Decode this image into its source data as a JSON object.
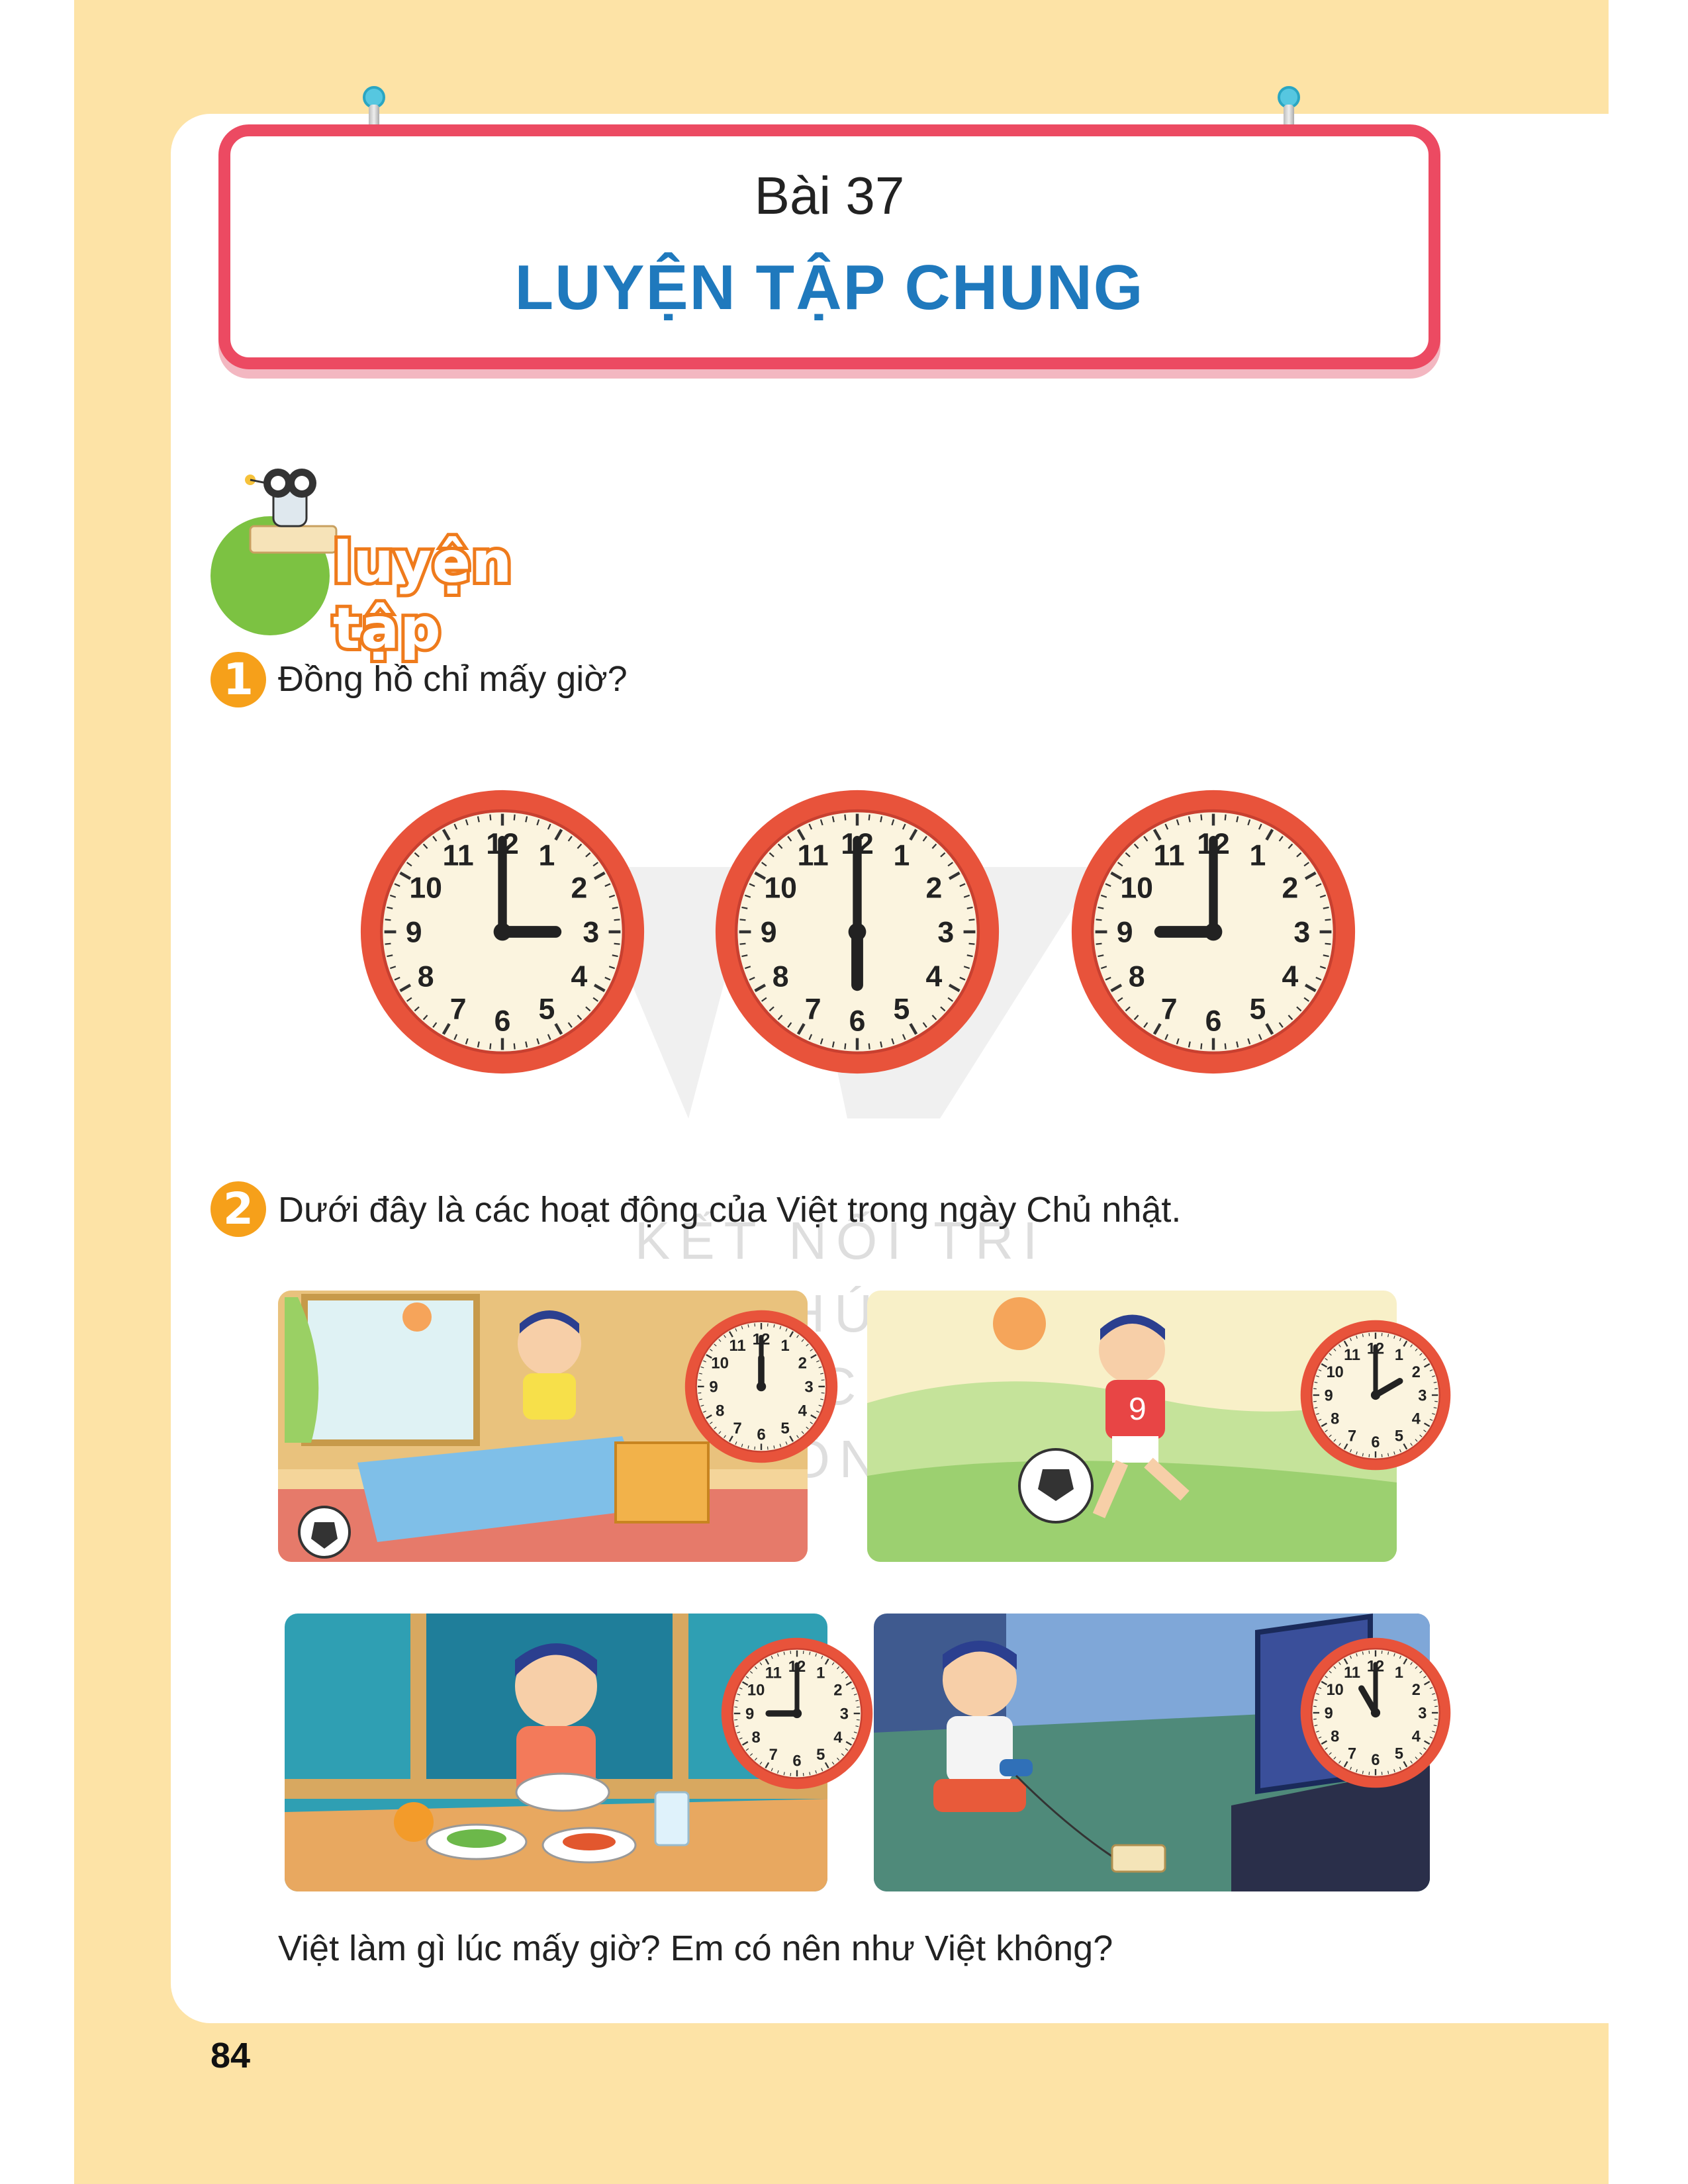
{
  "header": {
    "lesson_number": "Bài 37",
    "lesson_title": "LUYỆN TẬP CHUNG"
  },
  "section": {
    "badge_label": "luyện tập"
  },
  "exercise1": {
    "number": "1",
    "prompt": "Đồng hồ chỉ mấy giờ?",
    "clocks": [
      {
        "hour": 3,
        "minute": 0
      },
      {
        "hour": 6,
        "minute": 0
      },
      {
        "hour": 9,
        "minute": 0
      }
    ]
  },
  "exercise2": {
    "number": "2",
    "prompt": "Dưới đây là các hoạt động của Việt trong ngày Chủ nhật.",
    "scenes": [
      {
        "activity": "wake-up",
        "clock": {
          "hour": 12,
          "minute": 0
        }
      },
      {
        "activity": "play-football",
        "clock": {
          "hour": 2,
          "minute": 0
        }
      },
      {
        "activity": "eat-dinner",
        "clock": {
          "hour": 9,
          "minute": 0
        }
      },
      {
        "activity": "play-video-game",
        "clock": {
          "hour": 11,
          "minute": 0
        }
      }
    ],
    "question": "Việt làm gì lúc mấy giờ? Em có nên như Việt không?"
  },
  "watermark": {
    "line1": "KẾT NỐI TRI THỨC",
    "line2": "VỚI CUỘC SỐNG"
  },
  "footer": {
    "page_number": "84"
  },
  "colors": {
    "page_band": "#fde3a6",
    "title_border": "#ec4a62",
    "title_blue": "#1f79bd",
    "number_badge": "#f6a01a",
    "clock_rim": "#e8533b"
  }
}
